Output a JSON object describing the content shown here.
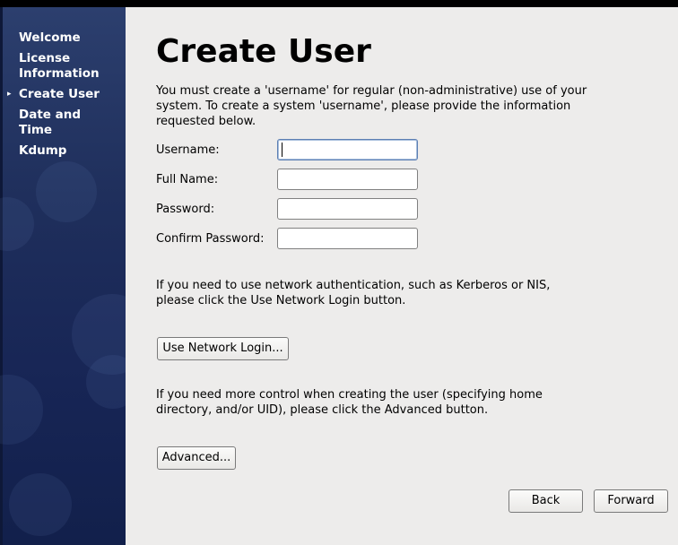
{
  "sidebar": {
    "items": [
      {
        "label": "Welcome"
      },
      {
        "label": "License Information"
      },
      {
        "label": "Create User",
        "current": true
      },
      {
        "label": "Date and Time"
      },
      {
        "label": "Kdump"
      }
    ],
    "current_marker": "▸"
  },
  "main": {
    "title": "Create User",
    "intro": "You must create a 'username' for regular (non-administrative) use of your system.  To create a system 'username', please provide the information requested below.",
    "fields": {
      "username": {
        "label": "Username:",
        "value": ""
      },
      "fullname": {
        "label": "Full Name:",
        "value": ""
      },
      "password": {
        "label": "Password:",
        "value": ""
      },
      "confirm": {
        "label": "Confirm Password:",
        "value": ""
      }
    },
    "network_text": "If you need to use network authentication, such as Kerberos or NIS, please click the Use Network Login button.",
    "network_button": "Use Network Login...",
    "advanced_text": "If you need more control when creating the user (specifying home directory, and/or UID), please click the Advanced button.",
    "advanced_button": "Advanced..."
  },
  "footer": {
    "back": "Back",
    "forward": "Forward"
  },
  "colors": {
    "sidebar": "#1f2f5c",
    "background": "#edeceb",
    "focus": "#5d7fb3"
  }
}
